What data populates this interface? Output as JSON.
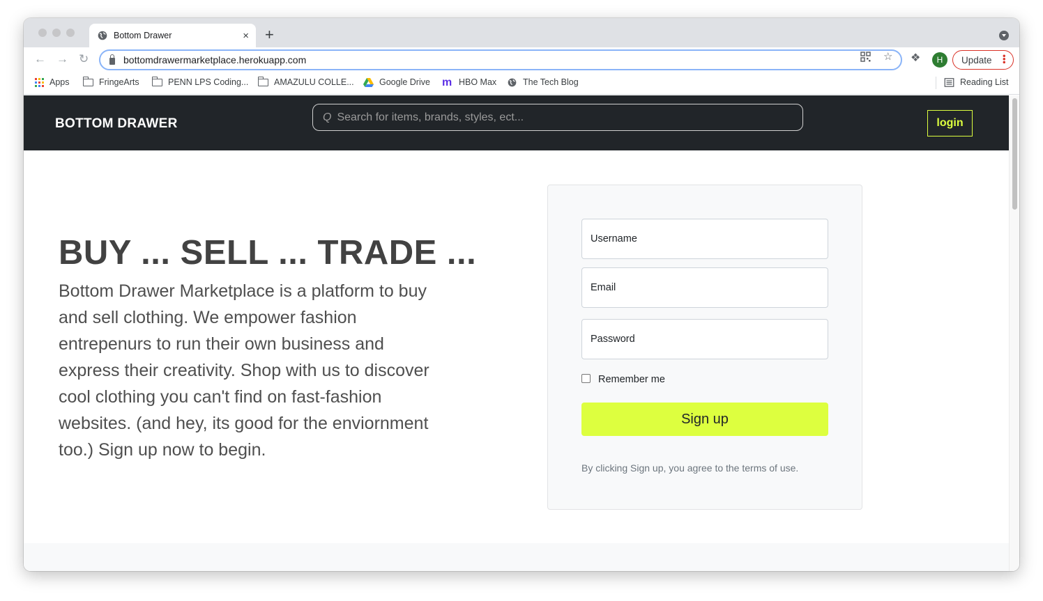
{
  "browser": {
    "tab_title": "Bottom Drawer",
    "tab_close": "×",
    "new_tab": "+",
    "url": "bottomdrawermarketplace.herokuapp.com",
    "profile_initial": "H",
    "update_label": "Update",
    "bookmarks": [
      {
        "label": "Apps",
        "icon": "apps-grid-icon"
      },
      {
        "label": "FringeArts",
        "icon": "folder-icon"
      },
      {
        "label": "PENN LPS Coding...",
        "icon": "folder-icon"
      },
      {
        "label": "AMAZULU COLLE...",
        "icon": "folder-icon"
      },
      {
        "label": "Google Drive",
        "icon": "google-drive-icon"
      },
      {
        "label": "HBO Max",
        "icon": "hbo-max-icon"
      },
      {
        "label": "The Tech Blog",
        "icon": "globe-icon"
      }
    ],
    "reading_list": "Reading List"
  },
  "site": {
    "brand": "BOTTOM DRAWER",
    "search_placeholder": "Search for items, brands, styles, ect...",
    "login_label": "login",
    "accent_color": "#ddff3f",
    "nav_color": "#212529"
  },
  "hero": {
    "title": "BUY ... SELL ... TRADE ...",
    "body": "Bottom Drawer Marketplace is a platform to buy and sell clothing. We empower fashion entrepenurs to run their own business and express their creativity. Shop with us to discover cool clothing you can't find on fast-fashion websites. (and hey, its good for the enviornment too.) Sign up now to begin."
  },
  "signup_form": {
    "username_placeholder": "Username",
    "email_placeholder": "Email",
    "password_placeholder": "Password",
    "remember_label": "Remember me",
    "remember_checked": false,
    "submit_label": "Sign up",
    "terms_text": "By clicking Sign up, you agree to the terms of use."
  }
}
